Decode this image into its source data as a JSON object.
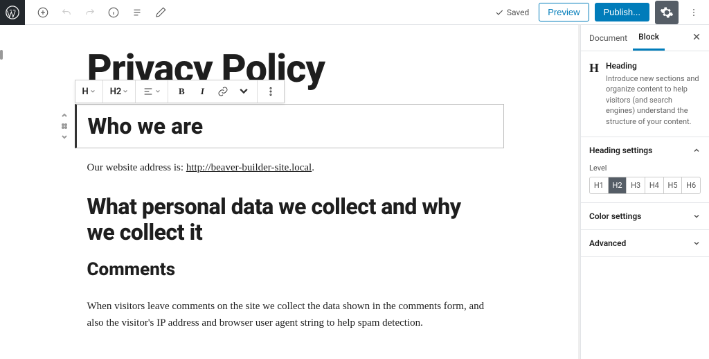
{
  "topbar": {
    "saved_label": "Saved",
    "preview_label": "Preview",
    "publish_label": "Publish..."
  },
  "content": {
    "title": "Privacy Policy",
    "heading_selected": "Who we are",
    "site_prefix": "Our website address is: ",
    "site_url": "http://beaver-builder-site.local",
    "h2_data": "What personal data we collect and why we collect it",
    "h3_comments": "Comments",
    "p_comments": "When visitors leave comments on the site we collect the data shown in the comments form, and also the visitor's IP address and browser user agent string to help spam detection."
  },
  "toolbar": {
    "heading_type": "H",
    "heading_level": "H2",
    "bold": "B",
    "italic": "I"
  },
  "sidebar": {
    "tabs": {
      "document": "Document",
      "block": "Block"
    },
    "block_info": {
      "icon": "H",
      "title": "Heading",
      "desc": "Introduce new sections and organize content to help visitors (and search engines) understand the structure of your content."
    },
    "panels": {
      "heading_settings": "Heading settings",
      "level_label": "Level",
      "levels": [
        "H1",
        "H2",
        "H3",
        "H4",
        "H5",
        "H6"
      ],
      "active_level": "H2",
      "color_settings": "Color settings",
      "advanced": "Advanced"
    }
  }
}
